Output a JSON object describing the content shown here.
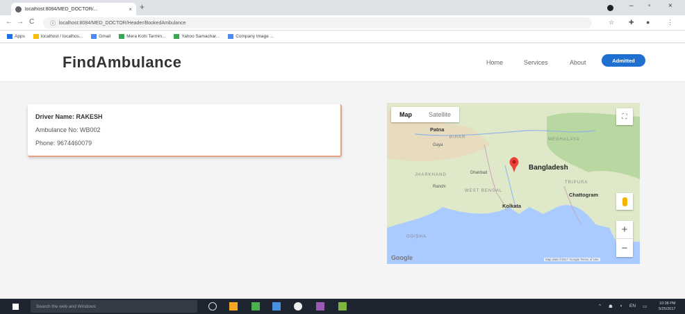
{
  "browser": {
    "tab_title": "localhost:8084/MED_DOCTOR/...",
    "tab_close": "×",
    "new_tab": "+",
    "url": "localhost:8084/MED_DOCTOR/Header/BookedAmbulance",
    "back": "←",
    "forward": "→",
    "reload": "C",
    "bookmarks": [
      {
        "label": "Apps"
      },
      {
        "label": "localhost / localhos..."
      },
      {
        "label": "Gmail"
      },
      {
        "label": "Mera Kohi Tarmin..."
      },
      {
        "label": "Yahoo Samachar..."
      },
      {
        "label": "Company Image ..."
      }
    ]
  },
  "navbar": {
    "brand": "FindAmbulance",
    "links": [
      "Home",
      "Services",
      "About"
    ],
    "button": "Admitted"
  },
  "driver": {
    "name_line": "Driver Name: RAKESH",
    "ambulance_line": "Ambulance No: WB002",
    "phone_line": "Phone: 9674460079"
  },
  "map": {
    "type_options": [
      "Map",
      "Satellite"
    ],
    "fullscreen": "⛶",
    "zoom_in": "+",
    "zoom_out": "−",
    "labels": {
      "bangladesh": "Bangladesh",
      "kolkata": "Kolkata",
      "patna": "Patna",
      "chattogram": "Chattogram",
      "bihar": "BIHAR",
      "jharkhand": "JHARKHAND",
      "west_bengal": "WEST BENGAL",
      "meghalaya": "MEGHALAYA",
      "tripura": "TRIPURA",
      "ranchi": "Ranchi",
      "gaya": "Gaya",
      "dhanbad": "Dhanbad",
      "odisha": "ODISHA"
    },
    "google": "Google",
    "terms": "Map data ©2017 Google  Terms of Use",
    "colors": {
      "land": "#d8e5c0",
      "water": "#aacbff",
      "marker": "#ea4335"
    }
  },
  "taskbar": {
    "search_placeholder": "Search the web and Windows",
    "time": "10:38 PM",
    "date": "5/25/2017"
  }
}
